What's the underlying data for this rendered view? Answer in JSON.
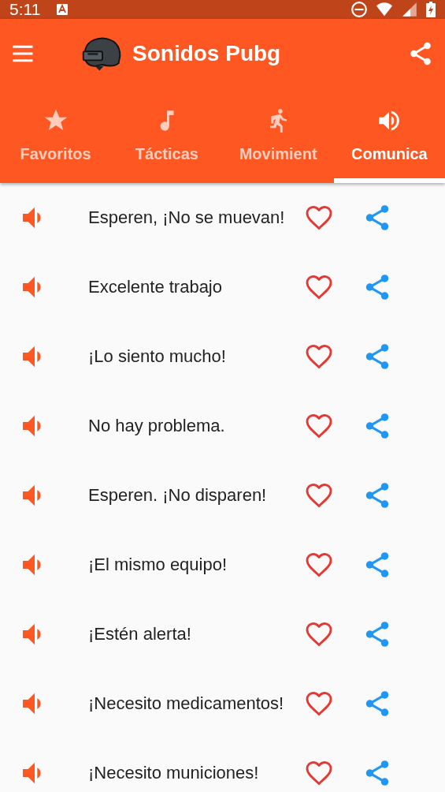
{
  "status_bar": {
    "time": "5:11"
  },
  "toolbar": {
    "title": "Sonidos Pubg"
  },
  "tabs": [
    {
      "label": "Favoritos",
      "selected": false
    },
    {
      "label": "Tácticas",
      "selected": false
    },
    {
      "label": "Movimient",
      "selected": false
    },
    {
      "label": "Comunica",
      "selected": true
    }
  ],
  "sounds": [
    {
      "label": "Esperen, ¡No se muevan!",
      "favorite": false
    },
    {
      "label": "Excelente trabajo",
      "favorite": false
    },
    {
      "label": "¡Lo siento mucho!",
      "favorite": false
    },
    {
      "label": "No hay problema.",
      "favorite": false
    },
    {
      "label": "Esperen. ¡No disparen!",
      "favorite": false
    },
    {
      "label": "¡El mismo equipo!",
      "favorite": false
    },
    {
      "label": "¡Estén alerta!",
      "favorite": false
    },
    {
      "label": "¡Necesito medicamentos!",
      "favorite": false
    },
    {
      "label": "¡Necesito municiones!",
      "favorite": false
    }
  ]
}
